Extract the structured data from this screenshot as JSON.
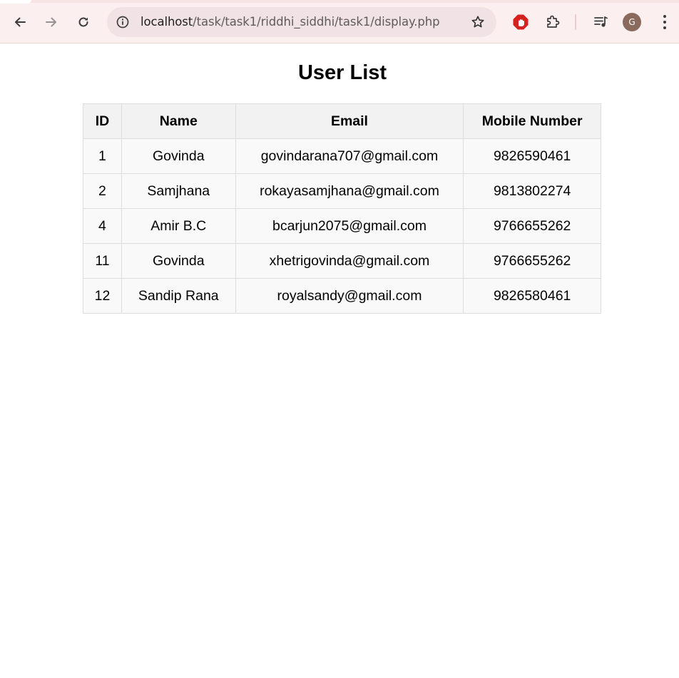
{
  "browser": {
    "url_host": "localhost",
    "url_path": "/task/task1/riddhi_siddhi/task1/display.php",
    "profile_initial": "G",
    "icons": [
      "back-arrow-icon",
      "forward-arrow-icon",
      "reload-icon",
      "site-info-icon",
      "star-icon",
      "adblock-icon",
      "extensions-puzzle-icon",
      "media-queue-icon",
      "profile-avatar",
      "more-menu-icon"
    ]
  },
  "page": {
    "title": "User List",
    "table": {
      "headers": [
        "ID",
        "Name",
        "Email",
        "Mobile Number"
      ],
      "rows": [
        [
          "1",
          "Govinda",
          "govindarana707@gmail.com",
          "9826590461"
        ],
        [
          "2",
          "Samjhana",
          "rokayasamjhana@gmail.com",
          "9813802274"
        ],
        [
          "4",
          "Amir B.C",
          "bcarjun2075@gmail.com",
          "9766655262"
        ],
        [
          "11",
          "Govinda",
          "xhetrigovinda@gmail.com",
          "9766655262"
        ],
        [
          "12",
          "Sandip Rana",
          "royalsandy@gmail.com",
          "9826580461"
        ]
      ]
    }
  },
  "colors": {
    "toolbar_bg": "#fcefef",
    "omnibox_bg": "#f1e3e5",
    "header_bg": "#f2f2f2",
    "row_bg": "#f9f9f9",
    "border": "#dddddd",
    "adblock_red": "#d8201f"
  }
}
